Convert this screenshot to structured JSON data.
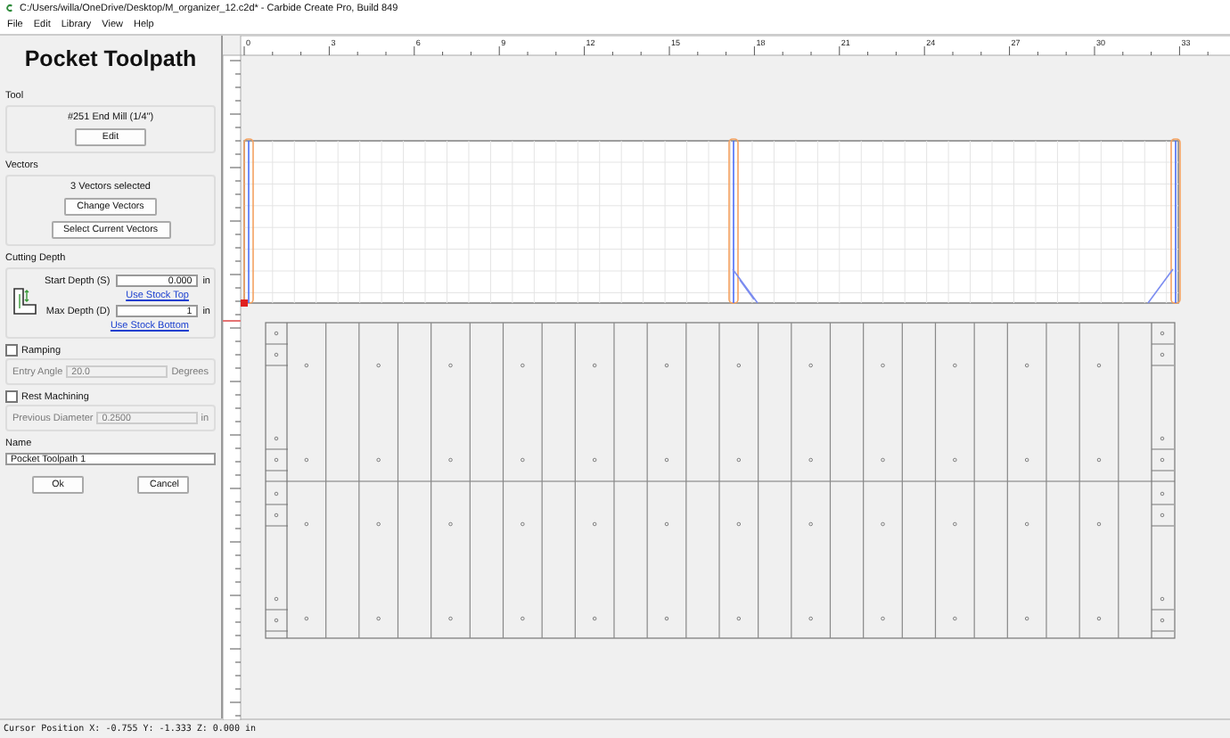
{
  "window": {
    "title": "C:/Users/willa/OneDrive/Desktop/M_organizer_12.c2d* - Carbide Create Pro, Build 849"
  },
  "menu": [
    "File",
    "Edit",
    "Library",
    "View",
    "Help"
  ],
  "panel": {
    "title": "Pocket Toolpath",
    "tool": {
      "heading": "Tool",
      "name": "#251 End Mill (1/4\")",
      "button": "Edit"
    },
    "vectors": {
      "heading": "Vectors",
      "summary": "3 Vectors selected",
      "buttons": [
        "Change Vectors",
        "Select Current Vectors"
      ]
    },
    "cutting_depth": {
      "heading": "Cutting Depth",
      "fields": [
        {
          "label": "Start Depth (S)",
          "value": "0.000",
          "unit": "in",
          "link": "Use Stock Top"
        },
        {
          "label": "Max Depth (D)",
          "value": "1",
          "unit": "in",
          "link": "Use Stock Bottom"
        }
      ]
    },
    "options": [
      {
        "label": "Ramping",
        "checked": false,
        "field": {
          "label": "Entry Angle",
          "value": "20.0",
          "unit": "Degrees"
        }
      },
      {
        "label": "Rest Machining",
        "checked": false,
        "field": {
          "label": "Previous Diameter",
          "value": "0.2500",
          "unit": "in"
        }
      }
    ],
    "name": {
      "heading": "Name",
      "value": "Pocket Toolpath 1"
    },
    "buttons": [
      "Ok",
      "Cancel"
    ]
  },
  "ruler": {
    "labels": [
      "0",
      "3",
      "6",
      "9",
      "12",
      "15",
      "18",
      "21",
      "24",
      "27",
      "30",
      "33"
    ]
  },
  "status_bar": "Cursor Position X: -0.755 Y: -1.333 Z: 0.000 in"
}
